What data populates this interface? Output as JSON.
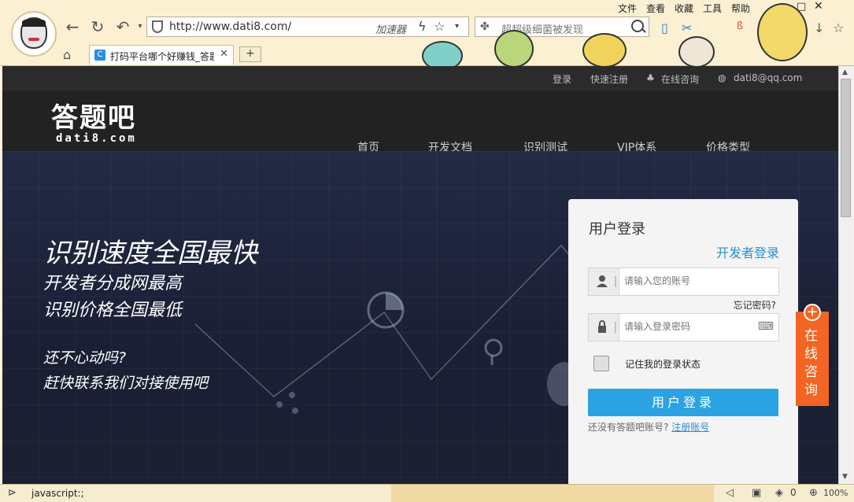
{
  "browser": {
    "url": "http://www.dati8.com/",
    "accelerator_label": "加速器",
    "search_hint": "超超级细菌被发现",
    "tab_title": "打码平台哪个好赚钱_答题",
    "menu": [
      "文件",
      "查看",
      "收藏",
      "工具",
      "帮助"
    ],
    "status_text": "javascript:;",
    "status_count": "0",
    "zoom": "100%"
  },
  "site": {
    "topbar": {
      "login": "登录",
      "register": "快速注册",
      "consult": "在线咨询",
      "email": "dati8@qq.com"
    },
    "logo_cn": "答题吧",
    "logo_en": "dati8.com",
    "nav": [
      "首页",
      "开发文档",
      "识别测试",
      "VIP体系",
      "价格类型"
    ],
    "slogans": [
      "识别速度全国最快",
      "开发者分成网最高",
      "识别价格全国最低",
      "还不心动吗?",
      "赶快联系我们对接使用吧"
    ]
  },
  "login": {
    "title": "用户登录",
    "developer_link": "开发者登录",
    "account_placeholder": "请输入您的账号",
    "forgot": "忘记密码?",
    "password_placeholder": "请输入登录密码",
    "remember": "记住我的登录状态",
    "button": "用户登录",
    "no_account": "还没有答题吧账号?",
    "register_link": "注册账号"
  },
  "float": {
    "consult": "在线咨询"
  },
  "colors": {
    "accent": "#2ba3e2",
    "float_orange": "#f26522",
    "header_bg": "#222222"
  }
}
